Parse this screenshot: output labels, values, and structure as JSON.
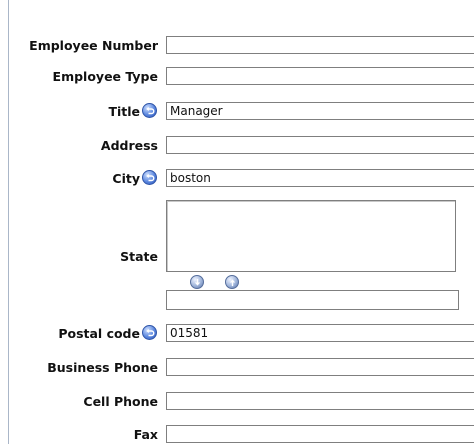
{
  "form": {
    "employee_number": {
      "label": "Employee Number",
      "value": ""
    },
    "employee_type": {
      "label": "Employee Type",
      "value": ""
    },
    "title": {
      "label": "Title",
      "value": "Manager"
    },
    "address": {
      "label": "Address",
      "value": ""
    },
    "city": {
      "label": "City",
      "value": "boston"
    },
    "state": {
      "label": "State",
      "entry_value": ""
    },
    "postal_code": {
      "label": "Postal code",
      "value": "01581"
    },
    "business_phone": {
      "label": "Business Phone",
      "value": ""
    },
    "cell_phone": {
      "label": "Cell Phone",
      "value": ""
    },
    "fax": {
      "label": "Fax",
      "value": ""
    }
  },
  "icons": {
    "reset": "revert-arrow-icon",
    "move_down": "down-arrow-icon",
    "move_up": "up-arrow-icon"
  }
}
